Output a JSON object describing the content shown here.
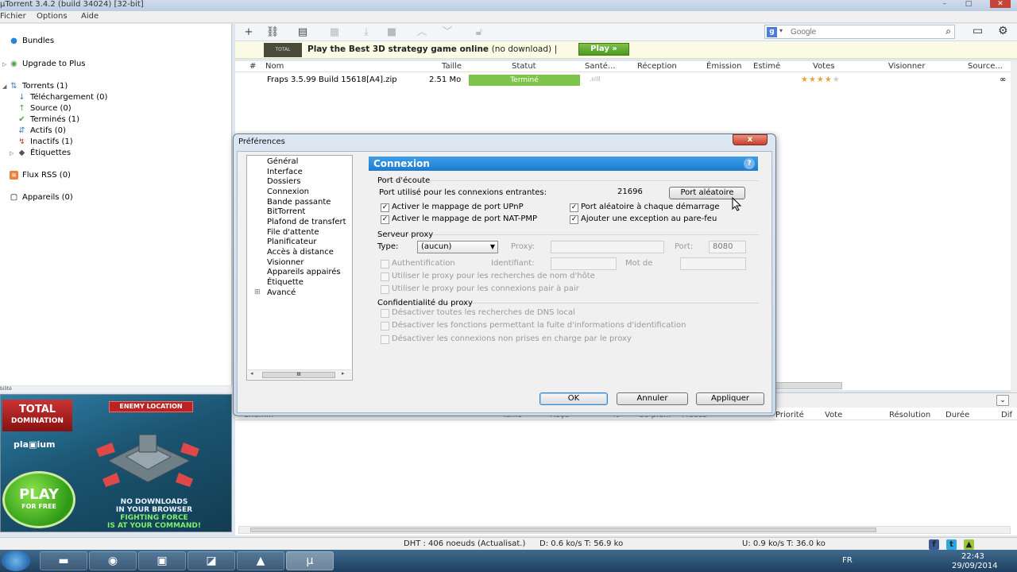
{
  "window": {
    "title": "µTorrent 3.4.2  (build 34024) [32-bit]"
  },
  "menu": [
    "Fichier",
    "Options",
    "Aide"
  ],
  "sidebar": {
    "bundles": "Bundles",
    "upgrade": "Upgrade to Plus",
    "torrents": "Torrents (1)",
    "telechargement": "Téléchargement (0)",
    "source": "Source (0)",
    "termines": "Terminés (1)",
    "actifs": "Actifs (0)",
    "inactifs": "Inactifs (1)",
    "etiquettes": "Étiquettes",
    "rss": "Flux RSS (0)",
    "appareils": "Appareils (0)",
    "status": "bilité"
  },
  "ad": {
    "logo_top": "TOTAL",
    "logo_bottom": "DOMINATION",
    "platform": "pla▣ium",
    "enemy": "ENEMY LOCATION",
    "play": "PLAY",
    "play_sub": "FOR FREE",
    "line1": "NO DOWNLOADS",
    "line2": "IN YOUR BROWSER",
    "line3": "FIGHTING FORCE",
    "line4": "IS AT YOUR COMMAND!"
  },
  "search": {
    "placeholder": "Google"
  },
  "banner": {
    "img": "TOTAL",
    "text": "Play the Best 3D strategy game online",
    "sub": "(no download)",
    "sep": "|",
    "play": "Play »"
  },
  "list": {
    "columns": [
      "#",
      "Nom",
      "Taille",
      "Statut",
      "Santé...",
      "Réception",
      "Émission",
      "Estimé",
      "Votes",
      "Visionner",
      "Source..."
    ],
    "rows": [
      {
        "name": "Fraps 3.5.99 Build 15618[A4].zip",
        "size": "2.51 Mo",
        "status": "Terminé",
        "health": ".ıılll",
        "stars": "★★★★★",
        "source": "∞",
        "rating": 4
      }
    ]
  },
  "lower": {
    "columns": [
      "Priorité",
      "Vote",
      "Résolution",
      "Durée",
      "Dif"
    ],
    "collapse": "⌄",
    "hidden": [
      "Chemin",
      "Taille",
      "Reçu",
      "%",
      "de pie...",
      "Pièces"
    ]
  },
  "statusbar": {
    "dht": "DHT : 406 noeuds (Actualisat.)",
    "down": "D: 0.6 ko/s T: 56.9 ko",
    "up": "U: 0.9 ko/s T: 36.0 ko"
  },
  "taskbar": {
    "lang": "FR",
    "time": "22:43",
    "date": "29/09/2014"
  },
  "dialog": {
    "title": "Préférences",
    "close": "x",
    "tree": [
      "Général",
      "Interface",
      "Dossiers",
      "Connexion",
      "Bande passante",
      "BitTorrent",
      "Plafond de transfert",
      "File d'attente",
      "Planificateur",
      "Accès à distance",
      "Visionner",
      "Appareils appairés",
      "Étiquette",
      "Avancé"
    ],
    "tree_scroll": "III",
    "section": "Connexion",
    "help": "?",
    "port_group": "Port d'écoute",
    "port_label": "Port utilisé pour les connexions entrantes:",
    "port_value": "21696",
    "random_btn": "Port aléatoire",
    "upnp": "Activer le mappage de port UPnP",
    "natpmp": "Activer le mappage de port NAT-PMP",
    "random_start": "Port aléatoire à chaque démarrage",
    "firewall": "Ajouter une exception au pare-feu",
    "proxy_group": "Serveur proxy",
    "type_label": "Type:",
    "type_value": "(aucun)",
    "proxy_label": "Proxy:",
    "port_short": "Port:",
    "proxy_port": "8080",
    "auth": "Authentification",
    "ident": "Identifiant:",
    "password": "Mot de",
    "proxy_host": "Utiliser le proxy pour les recherches de nom d'hôte",
    "proxy_p2p": "Utiliser le proxy pour les connexions pair à pair",
    "privacy_group": "Confidentialité du proxy",
    "dns": "Désactiver toutes les recherches de DNS local",
    "leak": "Désactiver les fonctions permettant la fuite d'informations d'identification",
    "unsupported": "Désactiver les connexions non prises en charge par le proxy",
    "ok": "OK",
    "cancel": "Annuler",
    "apply": "Appliquer"
  }
}
